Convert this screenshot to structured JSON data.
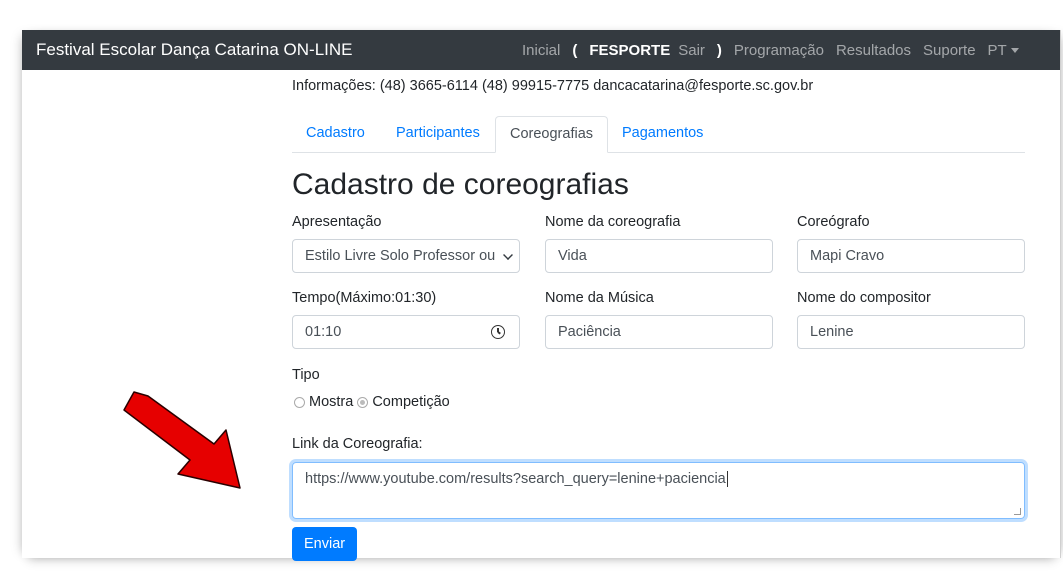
{
  "navbar": {
    "brand": "Festival Escolar Dança Catarina ON-LINE",
    "items": {
      "inicial": "Inicial",
      "open_paren": "(",
      "user": "FESPORTE",
      "sair": "Sair",
      "close_paren": ")",
      "programacao": "Programação",
      "resultados": "Resultados",
      "suporte": "Suporte",
      "lang": "PT"
    }
  },
  "info": "Informações: (48) 3665-6114 (48) 99915-7775 dancacatarina@fesporte.sc.gov.br",
  "tabs": [
    "Cadastro",
    "Participantes",
    "Coreografias",
    "Pagamentos"
  ],
  "active_tab": "Coreografias",
  "page_title": "Cadastro de coreografias",
  "form": {
    "apresentacao": {
      "label": "Apresentação",
      "value": "Estilo Livre Solo Professor ou"
    },
    "nome_coreografia": {
      "label": "Nome da coreografia",
      "value": "Vida"
    },
    "coreografo": {
      "label": "Coreógrafo",
      "value": "Mapi Cravo"
    },
    "tempo": {
      "label": "Tempo(Máximo:01:30)",
      "value": "01:10"
    },
    "nome_musica": {
      "label": "Nome da Música",
      "value": "Paciência"
    },
    "compositor": {
      "label": "Nome do compositor",
      "value": "Lenine"
    },
    "tipo": {
      "label": "Tipo",
      "options": [
        "Mostra",
        "Competição"
      ],
      "selected": "Competição"
    },
    "link": {
      "label": "Link da Coreografia:",
      "value": "https://www.youtube.com/results?search_query=lenine+paciencia"
    },
    "submit_label": "Enviar"
  },
  "colors": {
    "navbar": "#343a40",
    "primary": "#007bff",
    "arrow": "#e60000"
  },
  "icons": [
    "clock-icon",
    "select-chevron-icon",
    "red-arrow-annotation"
  ]
}
